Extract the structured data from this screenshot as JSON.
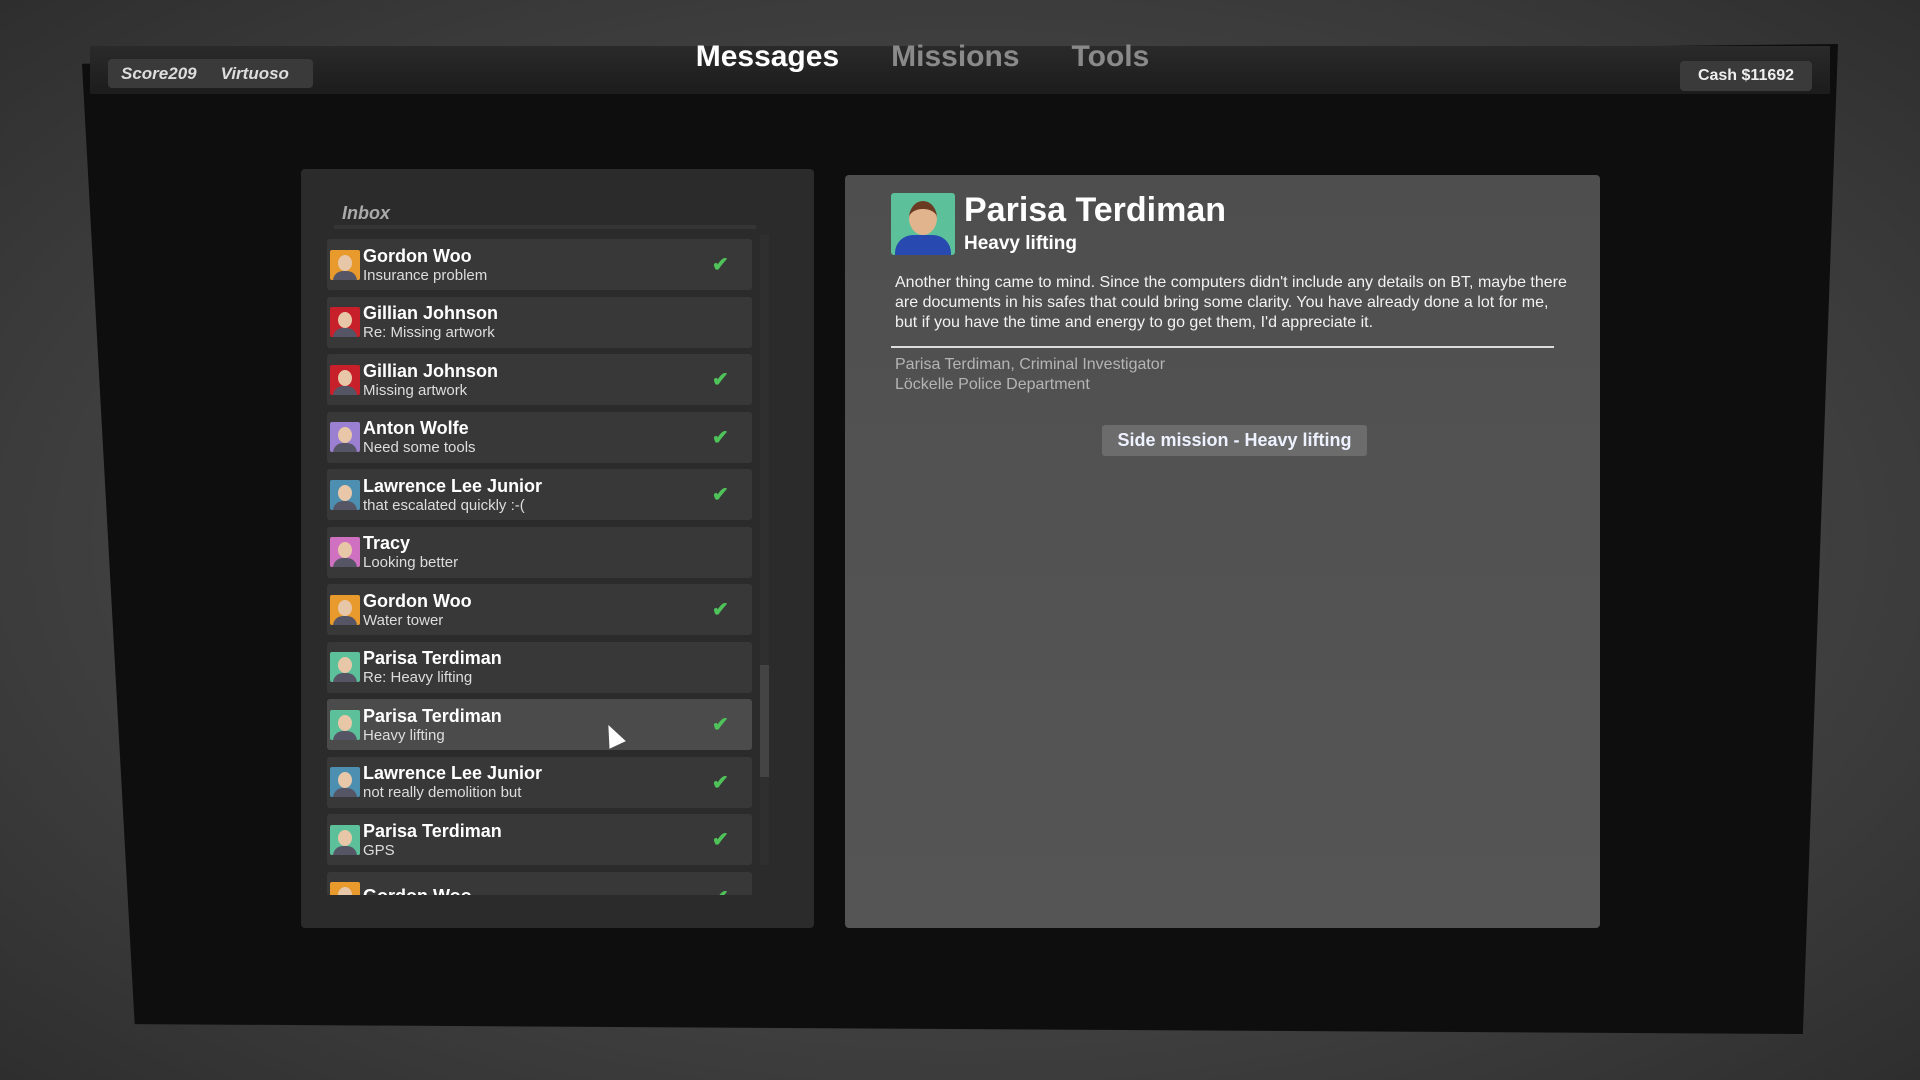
{
  "header": {
    "score_label": "Score209",
    "rank": "Virtuoso",
    "cash": "Cash $11692",
    "tabs": [
      {
        "label": "Messages",
        "active": true
      },
      {
        "label": "Missions",
        "active": false
      },
      {
        "label": "Tools",
        "active": false
      }
    ]
  },
  "inbox": {
    "title": "Inbox",
    "scroll_position_percent": 68,
    "items": [
      {
        "sender": "Gordon Woo",
        "subject": "Insurance problem",
        "done": true,
        "avatar_color": "#e89a2c"
      },
      {
        "sender": "Gillian Johnson",
        "subject": "Re: Missing artwork",
        "done": false,
        "avatar_color": "#c8202a"
      },
      {
        "sender": "Gillian Johnson",
        "subject": "Missing artwork",
        "done": true,
        "avatar_color": "#c8202a"
      },
      {
        "sender": "Anton Wolfe",
        "subject": "Need some tools",
        "done": true,
        "avatar_color": "#9b7fd0"
      },
      {
        "sender": "Lawrence Lee Junior",
        "subject": "that escalated quickly :-(",
        "done": true,
        "avatar_color": "#4d8fb0"
      },
      {
        "sender": "Tracy",
        "subject": "Looking better",
        "done": false,
        "avatar_color": "#d070c0"
      },
      {
        "sender": "Gordon Woo",
        "subject": "Water tower",
        "done": true,
        "avatar_color": "#e89a2c"
      },
      {
        "sender": "Parisa Terdiman",
        "subject": "Re: Heavy lifting",
        "done": false,
        "avatar_color": "#5cc09a"
      },
      {
        "sender": "Parisa Terdiman",
        "subject": "Heavy lifting",
        "done": true,
        "selected": true,
        "avatar_color": "#5cc09a"
      },
      {
        "sender": "Lawrence Lee Junior",
        "subject": "not really demolition but",
        "done": true,
        "avatar_color": "#4d8fb0"
      },
      {
        "sender": "Parisa Terdiman",
        "subject": "GPS",
        "done": true,
        "avatar_color": "#5cc09a"
      },
      {
        "sender": "Gordon Woo",
        "subject": "",
        "done": true,
        "avatar_color": "#e89a2c"
      }
    ]
  },
  "message": {
    "sender": "Parisa Terdiman",
    "subject": "Heavy lifting",
    "body": "Another thing came to mind. Since the computers didn't include any details on BT, maybe there are documents in his safes that could bring some clarity. You have already done a lot for me, but if you have the time and energy to go get them, I'd appreciate it.",
    "signature_line1": "Parisa Terdiman, Criminal Investigator",
    "signature_line2": "Löckelle Police Department",
    "action_button": "Side mission - Heavy lifting"
  },
  "colors": {
    "check": "#4fc35a",
    "panel": "#2b2b2b",
    "detail_panel": "#505050"
  }
}
